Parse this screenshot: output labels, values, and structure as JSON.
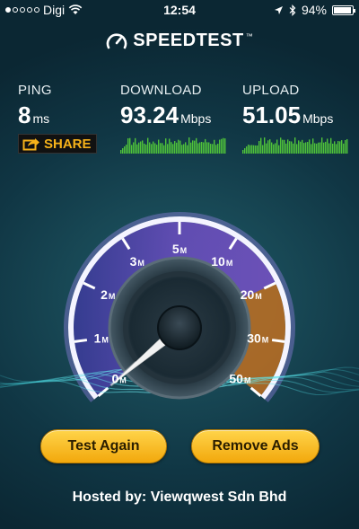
{
  "status_bar": {
    "carrier": "Digi",
    "time": "12:54",
    "battery": "94%",
    "battery_level": 0.94,
    "signal_bars": 1
  },
  "app": {
    "title": "SPEEDTEST"
  },
  "ping": {
    "label": "PING",
    "value": "8",
    "unit": "ms"
  },
  "download": {
    "label": "DOWNLOAD",
    "value": "93.24",
    "unit": "Mbps"
  },
  "upload": {
    "label": "UPLOAD",
    "value": "51.05",
    "unit": "Mbps"
  },
  "share": {
    "label": "SHARE"
  },
  "gauge": {
    "ticks": [
      "0",
      "1",
      "2",
      "3",
      "5",
      "10",
      "20",
      "30",
      "50"
    ],
    "tick_unit": "M",
    "needle_value": "0"
  },
  "buttons": {
    "test_again": "Test Again",
    "remove_ads": "Remove Ads"
  },
  "footer": {
    "hosted_by": "Hosted by: Viewqwest Sdn Bhd"
  },
  "colors": {
    "accent_orange": "#f2a80c",
    "graph_green": "#4fc23a",
    "gauge_purple": "#6a4ab8"
  }
}
